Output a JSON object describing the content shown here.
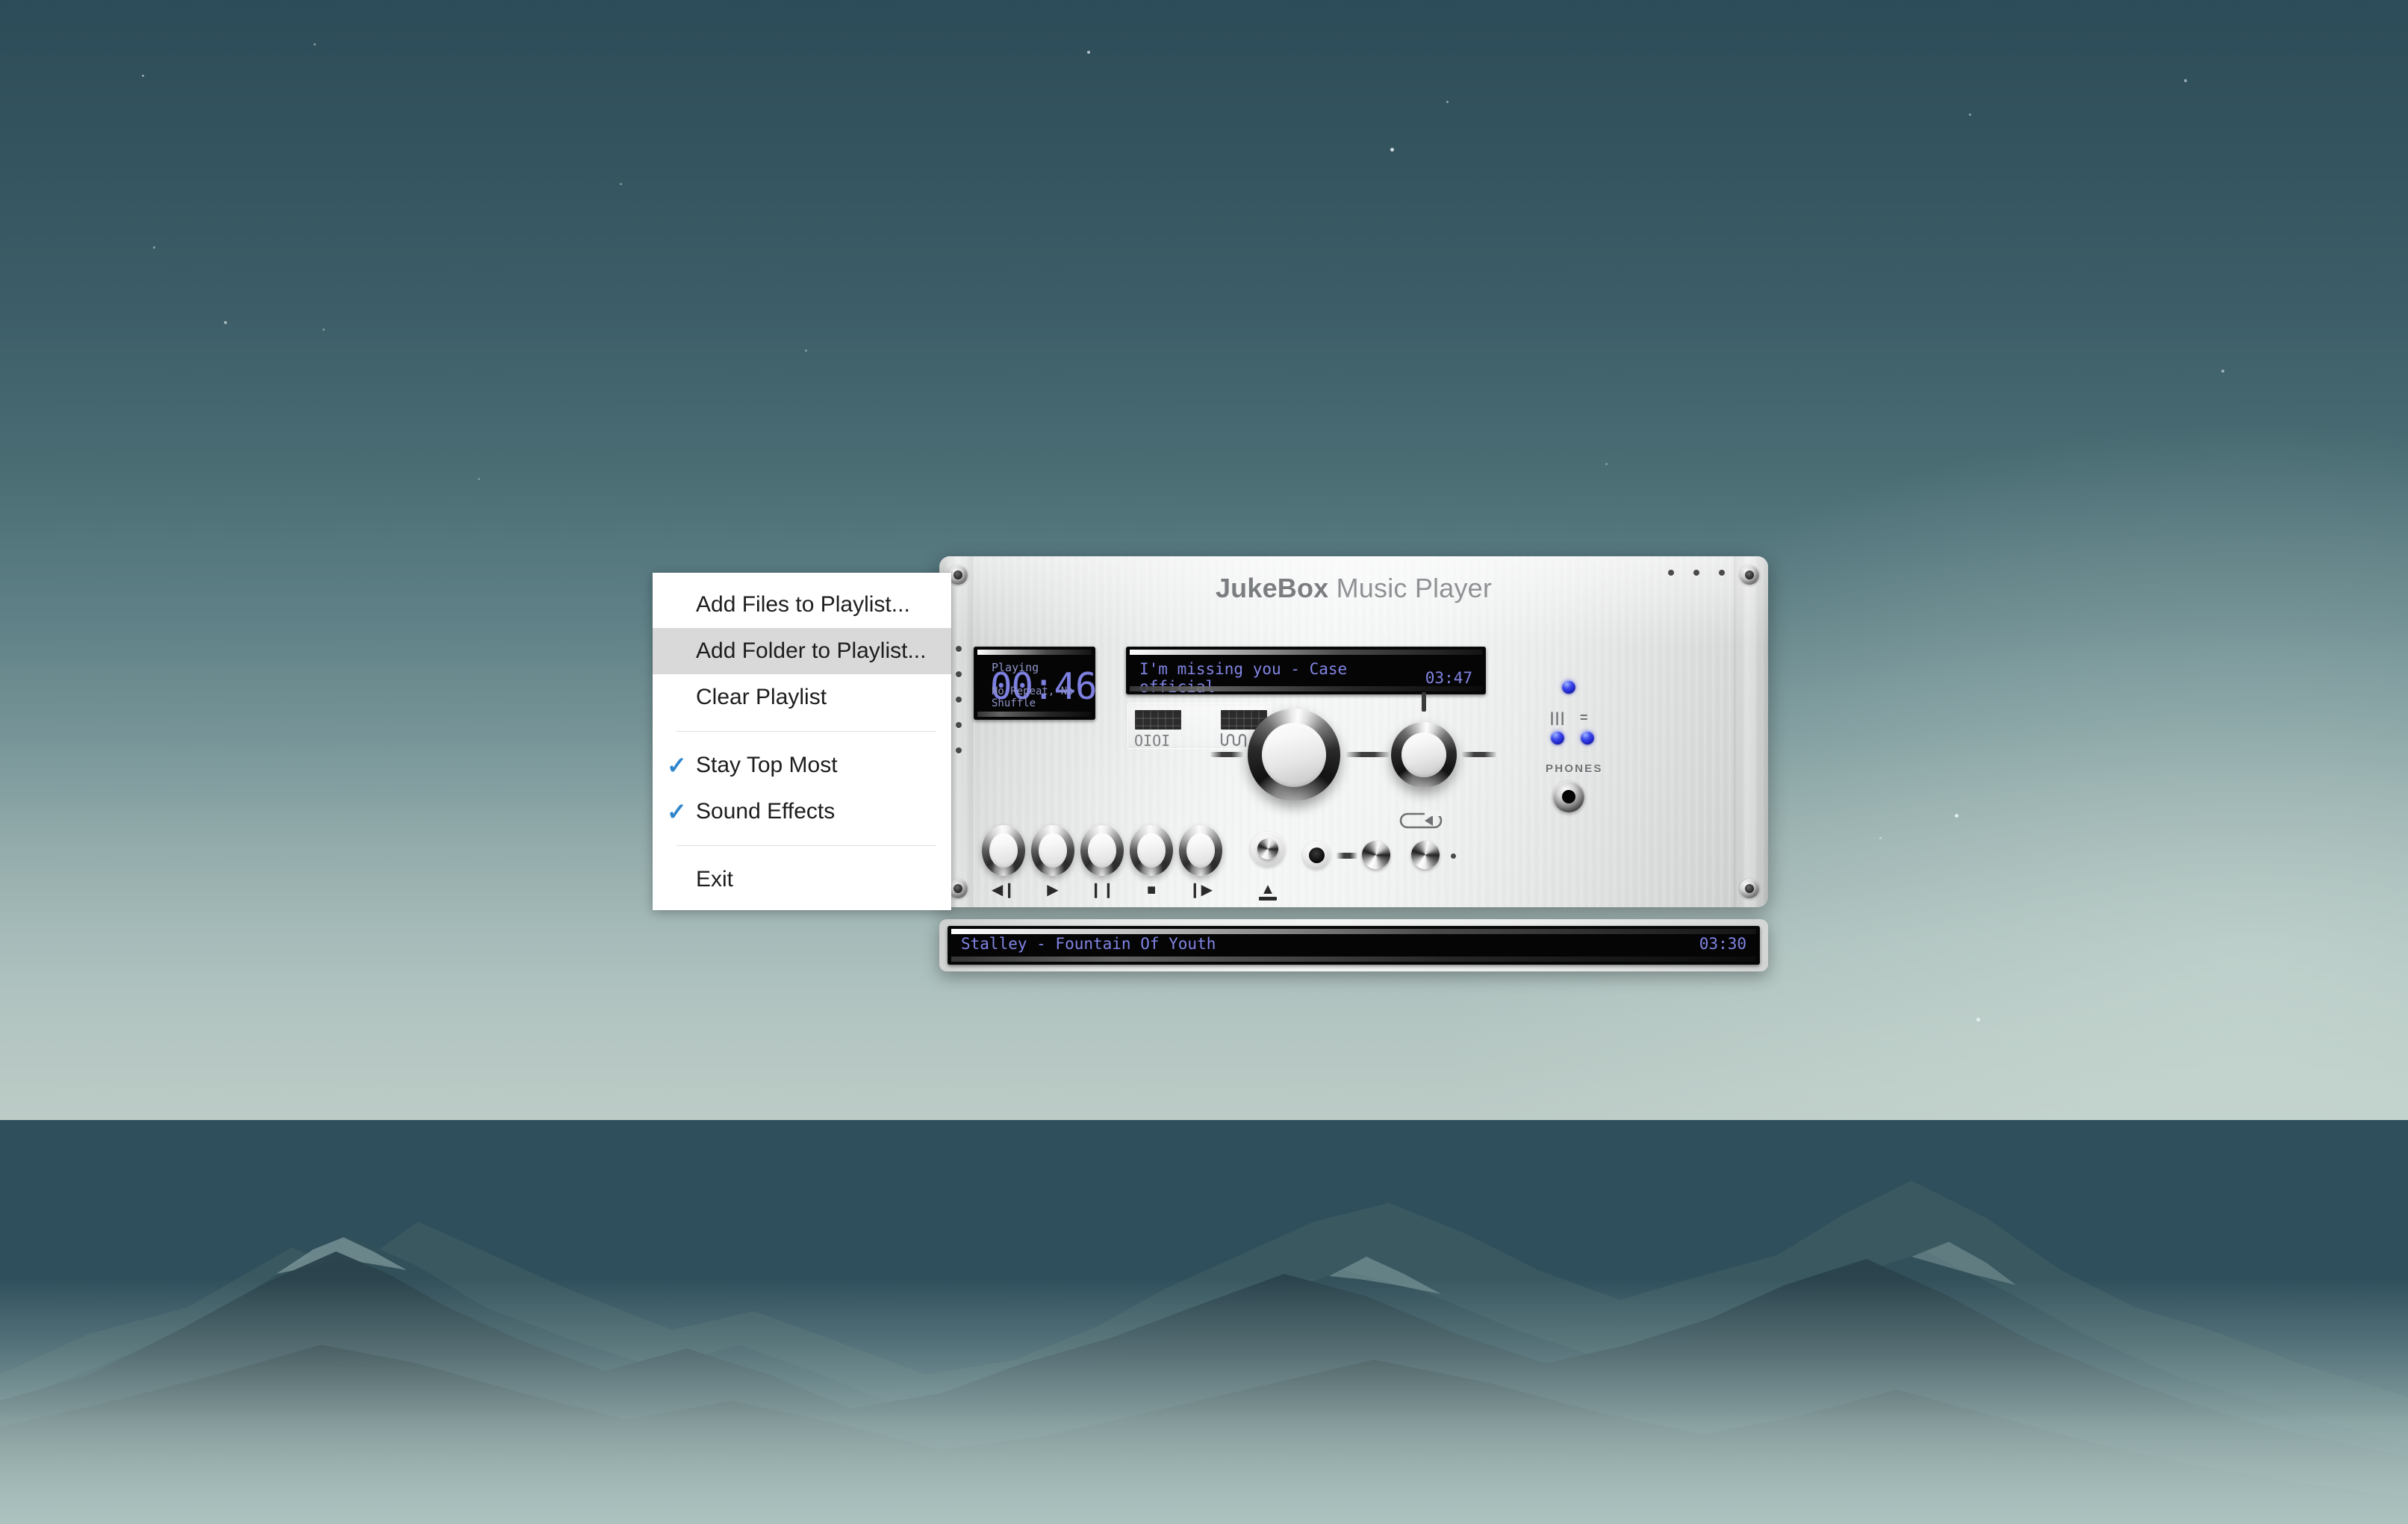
{
  "desktop": {
    "wallpaper_name": "mountain-night-wallpaper",
    "sky_top_color": "#2d4c59",
    "sky_horizon_color": "#bccbc6",
    "mountain_color": "#2c4249"
  },
  "context_menu": {
    "items": [
      {
        "label": "Add Files to Playlist...",
        "checked": false,
        "highlighted": false
      },
      {
        "label": "Add Folder to Playlist...",
        "checked": false,
        "highlighted": true
      },
      {
        "label": "Clear Playlist",
        "checked": false,
        "highlighted": false
      },
      {
        "label": "Stay Top Most",
        "checked": true,
        "highlighted": false
      },
      {
        "label": "Sound Effects",
        "checked": true,
        "highlighted": false
      },
      {
        "label": "Exit",
        "checked": false,
        "highlighted": false
      }
    ],
    "check_glyph": "✓",
    "check_color": "#2f85cc",
    "highlight_color": "#d9d9d9"
  },
  "player": {
    "title_bold": "JukeBox",
    "title_rest": " Music Player",
    "time_display": {
      "status": "Playing",
      "elapsed": "00:46",
      "mode": "No Repeat, No Shuffle",
      "text_color": "#7d80e0"
    },
    "track_display": {
      "title": "I'm missing you - Case official",
      "duration": "03:47"
    },
    "meters": {
      "digital_label": "OIOI",
      "analog_label": "͵͵͵"
    },
    "transport": [
      {
        "name": "previous",
        "glyph": "◀❙"
      },
      {
        "name": "play",
        "glyph": "▶"
      },
      {
        "name": "pause",
        "glyph": "❙❙"
      },
      {
        "name": "stop",
        "glyph": "■"
      },
      {
        "name": "next",
        "glyph": "❙▶"
      }
    ],
    "eject_glyph": "▲",
    "repeat_icon": "loop-arrow-icon",
    "phones_label": "PHONES",
    "led_caps": {
      "left": "|||",
      "right": "="
    },
    "led_color": "#3b47ea"
  },
  "playlist": {
    "entries": [
      {
        "title": "Stalley - Fountain Of Youth",
        "duration": "03:30"
      }
    ]
  }
}
